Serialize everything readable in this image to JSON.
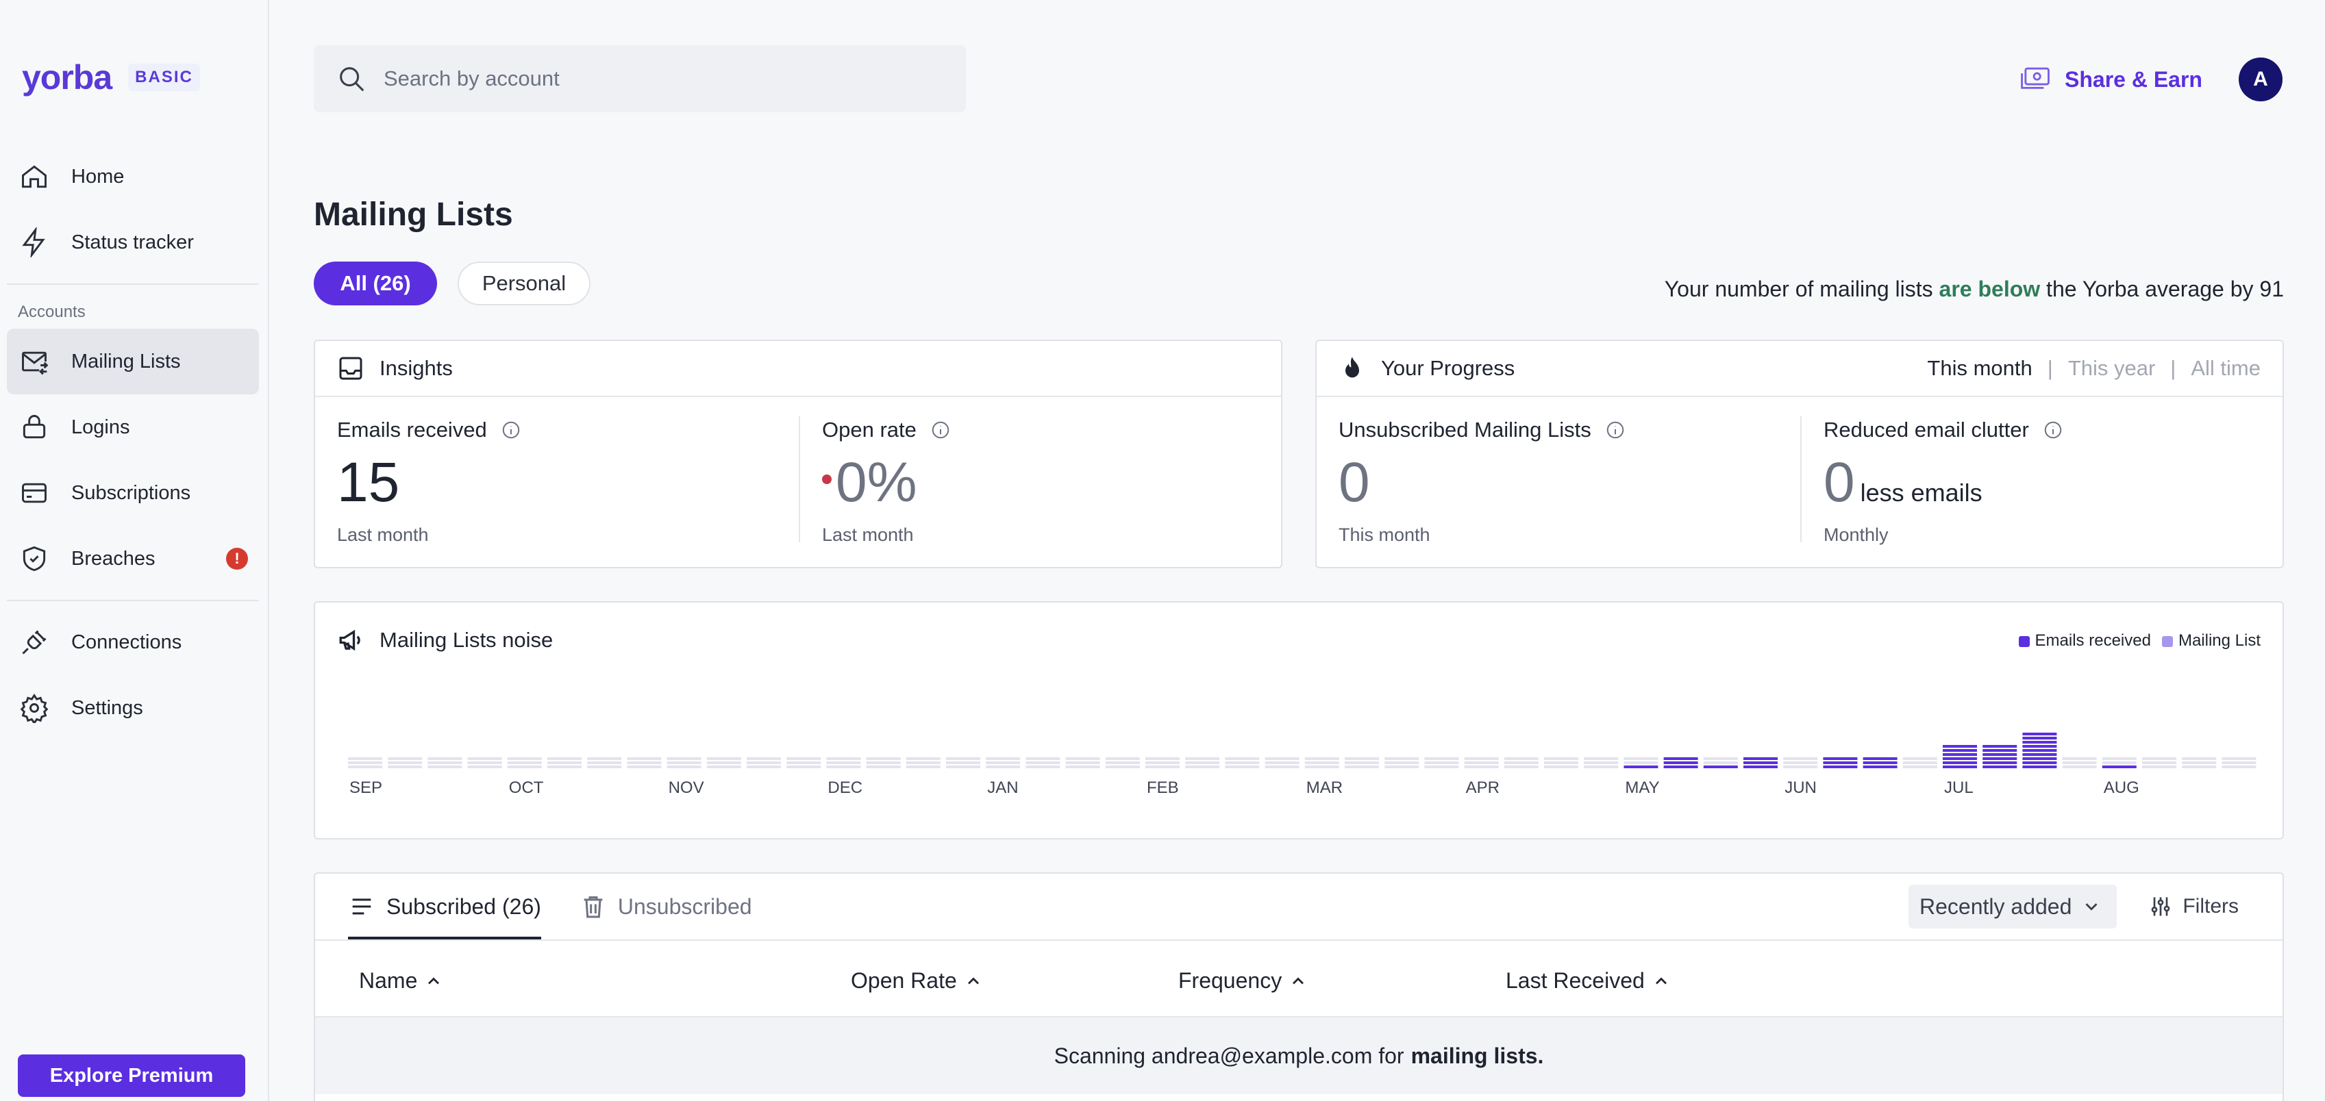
{
  "brand": {
    "name": "yorba",
    "plan": "BASIC"
  },
  "sidebar": {
    "items_top": [
      {
        "label": "Home",
        "icon": "home-icon"
      },
      {
        "label": "Status tracker",
        "icon": "bolt-icon"
      }
    ],
    "section_label": "Accounts",
    "items_accounts": [
      {
        "label": "Mailing Lists",
        "icon": "mail-swap-icon",
        "active": true
      },
      {
        "label": "Logins",
        "icon": "lock-icon"
      },
      {
        "label": "Subscriptions",
        "icon": "card-icon"
      },
      {
        "label": "Breaches",
        "icon": "shield-icon",
        "badge": "!"
      }
    ],
    "items_bottom": [
      {
        "label": "Connections",
        "icon": "plug-icon"
      },
      {
        "label": "Settings",
        "icon": "gear-icon"
      }
    ],
    "premium_label": "Explore Premium"
  },
  "header": {
    "search_placeholder": "Search by account",
    "share_label": "Share & Earn",
    "avatar_initial": "A"
  },
  "page": {
    "title": "Mailing Lists",
    "filter_all": "All (26)",
    "filter_personal": "Personal",
    "avg_prefix": "Your number of mailing lists",
    "avg_highlight": "are below",
    "avg_suffix": "the Yorba average by 91"
  },
  "insights": {
    "title": "Insights",
    "emails_label": "Emails received",
    "emails_value": "15",
    "emails_sub": "Last month",
    "open_label": "Open rate",
    "open_value": "0%",
    "open_sub": "Last month"
  },
  "progress": {
    "title": "Your Progress",
    "periods": [
      "This month",
      "|",
      "This year",
      "|",
      "All time"
    ],
    "unsub_label": "Unsubscribed Mailing Lists",
    "unsub_value": "0",
    "unsub_sub": "This month",
    "clutter_label": "Reduced email clutter",
    "clutter_value": "0",
    "clutter_suffix": "less emails",
    "clutter_sub": "Monthly"
  },
  "noise": {
    "title": "Mailing Lists noise",
    "legend": [
      {
        "label": "Emails received",
        "color": "#5b2fe0"
      },
      {
        "label": "Mailing List",
        "color": "#a796ee"
      }
    ]
  },
  "chart_data": {
    "type": "bar",
    "title": "Mailing Lists noise",
    "months": [
      "SEP",
      "OCT",
      "NOV",
      "DEC",
      "JAN",
      "FEB",
      "MAR",
      "APR",
      "MAY",
      "JUN",
      "JUL",
      "AUG"
    ],
    "bars_per_month": 4,
    "series": [
      {
        "name": "Emails received",
        "color": "#5b2fe0",
        "values": [
          0,
          0,
          0,
          0,
          0,
          0,
          0,
          0,
          0,
          0,
          0,
          0,
          0,
          0,
          0,
          0,
          0,
          0,
          0,
          0,
          0,
          0,
          0,
          0,
          0,
          0,
          0,
          0,
          0,
          0,
          0,
          0,
          1,
          3,
          1,
          3,
          0,
          3,
          3,
          0,
          6,
          6,
          9,
          0,
          1,
          0,
          0,
          0
        ]
      }
    ]
  },
  "table": {
    "tab_subscribed": "Subscribed (26)",
    "tab_unsubscribed": "Unsubscribed",
    "sort_label": "Recently added",
    "filters_label": "Filters",
    "columns": [
      "Name",
      "Open Rate",
      "Frequency",
      "Last Received"
    ],
    "scan_prefix": "Scanning andrea@example.com for",
    "scan_bold": "mailing lists."
  }
}
